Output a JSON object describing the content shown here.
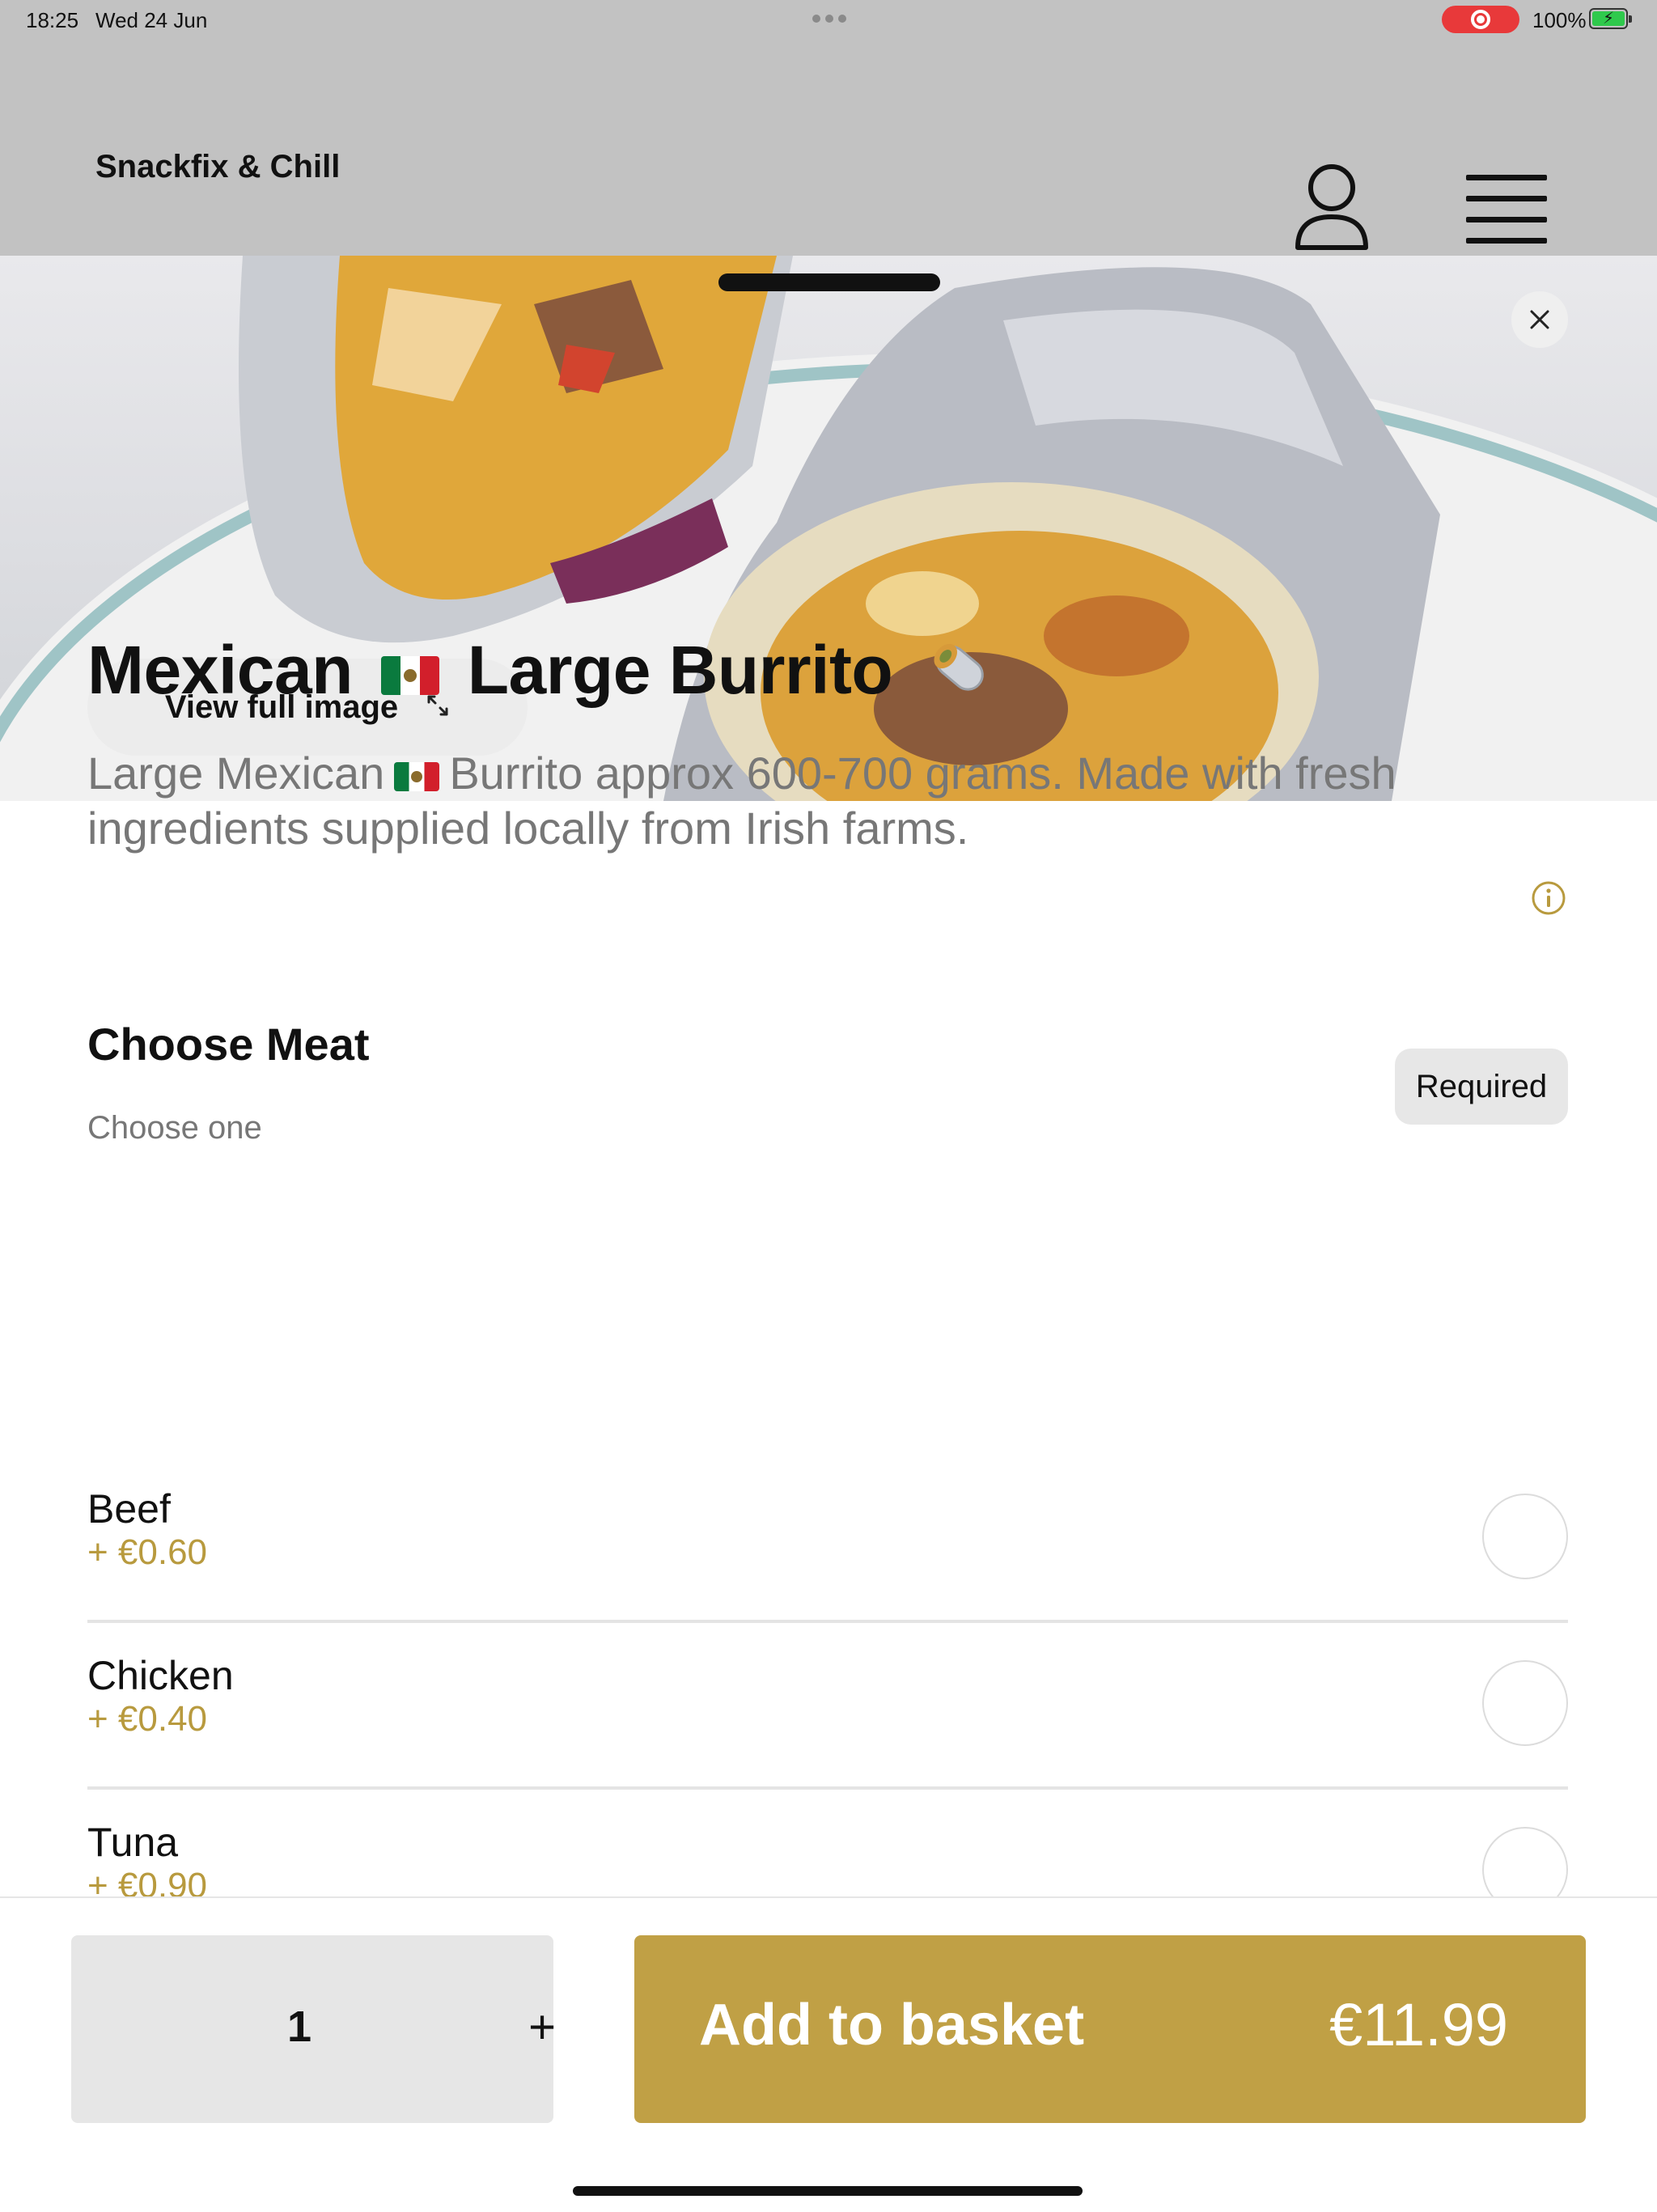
{
  "status": {
    "time": "18:25",
    "date": "Wed 24 Jun",
    "battery": "100%"
  },
  "header": {
    "brand": "Snackfix & Chill"
  },
  "hero": {
    "view_full_label": "View full image"
  },
  "product": {
    "title_part1": "Mexican",
    "title_part2": "Large Burrito",
    "desc_part1": "Large Mexican",
    "desc_part2": "Burrito approx 600-700 grams. Made with fresh ingredients supplied locally from Irish farms."
  },
  "section": {
    "title": "Choose Meat",
    "subtitle": "Choose one",
    "badge": "Required",
    "options": [
      {
        "name": "Beef",
        "price": "+ €0.60"
      },
      {
        "name": "Chicken",
        "price": "+ €0.40"
      },
      {
        "name": "Tuna",
        "price": "+ €0.90"
      }
    ]
  },
  "basket": {
    "quantity": "1",
    "plus": "+",
    "add_label": "Add to basket",
    "price": "€11.99"
  },
  "colors": {
    "accent": "#c0a045",
    "price_text": "#b89a3e",
    "backdrop": "#c2c2c2"
  }
}
